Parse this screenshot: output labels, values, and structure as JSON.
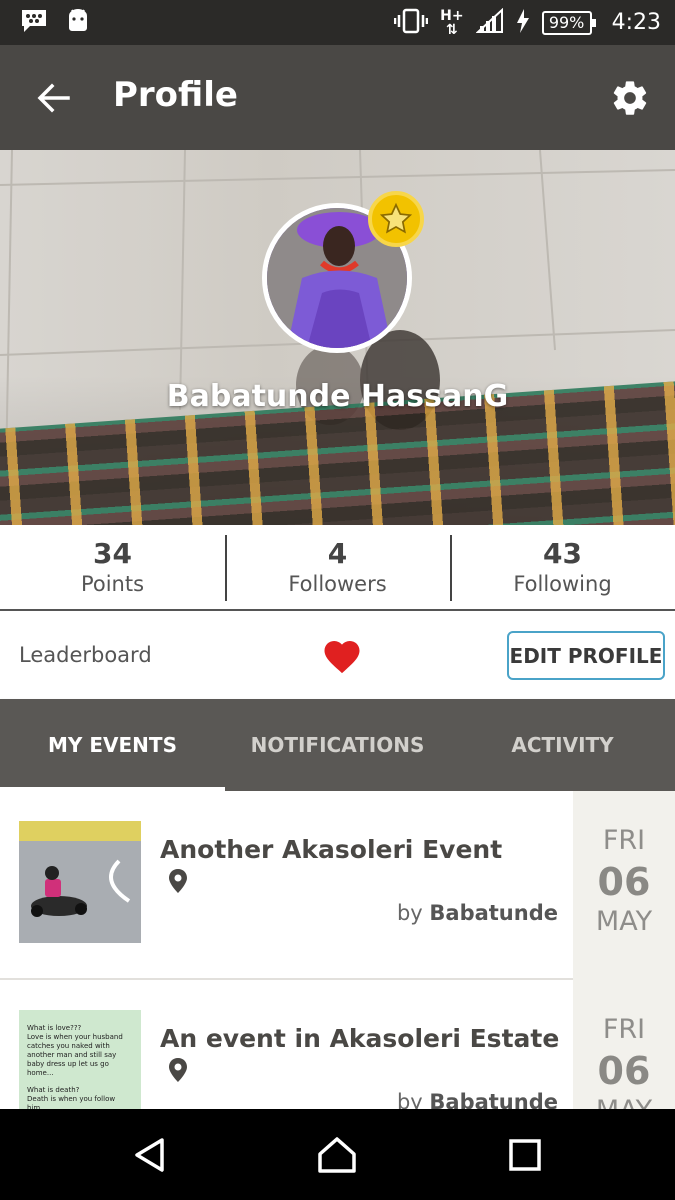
{
  "status_bar": {
    "battery": "99%",
    "time": "4:23",
    "network": "H+"
  },
  "app_bar": {
    "title": "Profile"
  },
  "profile": {
    "name": "Babatunde HassanG"
  },
  "stats": [
    {
      "value": "34",
      "label": "Points"
    },
    {
      "value": "4",
      "label": "Followers"
    },
    {
      "value": "43",
      "label": "Following"
    }
  ],
  "actions": {
    "leaderboard": "Leaderboard",
    "edit_profile": "EDIT PROFILE"
  },
  "tabs": [
    {
      "label": "MY EVENTS",
      "active": true
    },
    {
      "label": "NOTIFICATIONS",
      "active": false
    },
    {
      "label": "ACTIVITY",
      "active": false
    }
  ],
  "events": [
    {
      "title": "Another Akasoleri Event",
      "by_prefix": "by",
      "by_name": "Babatunde",
      "dow": "FRI",
      "day": "06",
      "month": "MAY"
    },
    {
      "title": "An event in Akasoleri Estate",
      "by_prefix": "by",
      "by_name": "Babatunde",
      "dow": "FRI",
      "day": "06",
      "month": "MAY"
    }
  ],
  "thumb2_text": {
    "line1": "What is love???",
    "line2": "Love is when your husband catches you naked with another man and still say baby dress up let us go home...",
    "line3": "What is death?",
    "line4": "Death is when you follow him..."
  },
  "colors": {
    "app_bar": "#4a4845",
    "tabs": "#5a5855",
    "accent_border": "#4aa3c8",
    "heart": "#e02020",
    "badge": "#f2c200"
  }
}
